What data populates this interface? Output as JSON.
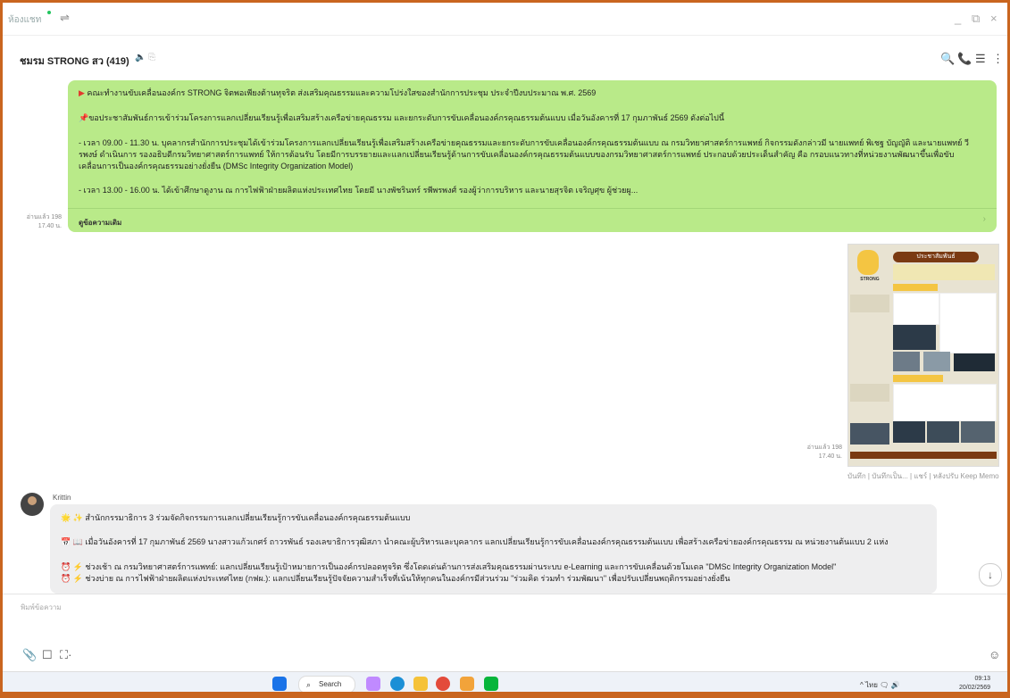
{
  "titlebar": {
    "label": "ห้องแชท",
    "window_controls": [
      "_",
      "⧉",
      "×"
    ]
  },
  "chat": {
    "title": "ชมรม STRONG สว (419)",
    "sub_icons": "🔈 ⎘"
  },
  "header_icons": [
    "🔍",
    "📞",
    "☰",
    "⋮"
  ],
  "message1": {
    "line1": "คณะทำงานขับเคลื่อนองค์กร STRONG จิตพอเพียงต้านทุจริต ส่งเสริมคุณธรรมและความโปร่งใสของสำนักการประชุม ประจำปีงบประมาณ พ.ศ. 2569",
    "line2": "ขอประชาสัมพันธ์การเข้าร่วมโครงการแลกเปลี่ยนเรียนรู้เพื่อเสริมสร้างเครือข่ายคุณธรรม และยกระดับการขับเคลื่อนองค์กรคุณธรรมต้นแบบ เมื่อวันอังคารที่ 17 กุมภาพันธ์ 2569 ดังต่อไปนี้",
    "line3": "- เวลา 09.00 - 11.30 น. บุคลากรสำนักการประชุมได้เข้าร่วมโครงการแลกเปลี่ยนเรียนรู้เพื่อเสริมสร้างเครือข่ายคุณธรรมและยกระดับการขับเคลื่อนองค์กรคุณธรรมต้นแบบ ณ กรมวิทยาศาสตร์การแพทย์ กิจกรรมดังกล่าวมี นายแพทย์ พิเชฐ บัญญัติ และนายแพทย์ วีรพงษ์ ดำเนินการ รองอธิบดีกรมวิทยาศาสตร์การแพทย์ ให้การต้อนรับ โดยมีการบรรยายและแลกเปลี่ยนเรียนรู้ด้านการขับเคลื่อนองค์กรคุณธรรมต้นแบบของกรมวิทยาศาสตร์การแพทย์ ประกอบด้วยประเด็นสำคัญ คือ กรอบแนวทางที่หน่วยงานพัฒนาขึ้นเพื่อขับเคลื่อนการเป็นองค์กรคุณธรรมอย่างยั่งยืน (DMSc Integrity Organization Model)",
    "line4": "- เวลา 13.00 - 16.00 น. ได้เข้าศึกษาดูงาน ณ การไฟฟ้าฝ่ายผลิตแห่งประเทศไทย โดยมี นางพัชรินทร์ รพีพรพงศ์ รองผู้ว่าการบริหาร และนายสุรจิต เจริญศุข ผู้ช่วยผู...",
    "read_more": "ดูข้อความเดิม",
    "meta_read": "อ่านแล้ว 198",
    "meta_time": "17.40 น."
  },
  "message2": {
    "poster_banner": "ประชาสัมพันธ์",
    "poster_logo": "STRONG",
    "meta_read": "อ่านแล้ว 198",
    "meta_time": "17.40 น.",
    "actions": "บันทึก  |  บันทึกเป็น...  |  แชร์  |  หลังปรับ Keep Memo"
  },
  "message3": {
    "sender": "Krittin",
    "line1": "🌟 ✨ สำนักกรรมาธิการ 3 ร่วมจัดกิจกรรมการแลกเปลี่ยนเรียนรู้การขับเคลื่อนองค์กรคุณธรรมต้นแบบ",
    "line2": "📅 📖 เมื่อวันอังคารที่ 17 กุมภาพันธ์ 2569 นางสาวแก้วเกศร์ ถาวรพันธ์ รองเลขาธิการวุฒิสภา นำคณะผู้บริหารและบุคลากร แลกเปลี่ยนเรียนรู้การขับเคลื่อนองค์กรคุณธรรมต้นแบบ เพื่อสร้างเครือข่ายองค์กรคุณธรรม ณ หน่วยงานต้นแบบ 2 แห่ง",
    "line3": "⏰ ⚡ ช่วงเช้า ณ กรมวิทยาศาสตร์การแพทย์: แลกเปลี่ยนเรียนรู้เป้าหมายการเป็นองค์กรปลอดทุจริต ซึ่งโดดเด่นด้านการส่งเสริมคุณธรรมผ่านระบบ e-Learning และการขับเคลื่อนด้วยโมเดล \"DMSc Integrity Organization Model\"",
    "line4": "⏰ ⚡ ช่วงบ่าย ณ การไฟฟ้าฝ่ายผลิตแห่งประเทศไทย (กฟผ.): แลกเปลี่ยนเรียนรู้ปัจจัยความสำเร็จที่เน้นให้ทุกคนในองค์กรมีส่วนร่วม \"ร่วมคิด ร่วมทำ ร่วมพัฒนา\" เพื่อปรับเปลี่ยนพฤติกรรมอย่างยั่งยืน"
  },
  "composer": {
    "placeholder": "พิมพ์ข้อความ",
    "tools": [
      "📎",
      "☐",
      "⛶·"
    ],
    "emoji": "☺"
  },
  "taskbar": {
    "search": "Search",
    "tray": "^   ไทย   🗨 🔊",
    "time": "09:13",
    "date": "20/02/2569"
  },
  "colors": {
    "accent_border": "#c9651f",
    "bubble_green": "#b9ea89",
    "bubble_gray": "#eeeeef",
    "poster_brown": "#7a3a12"
  }
}
